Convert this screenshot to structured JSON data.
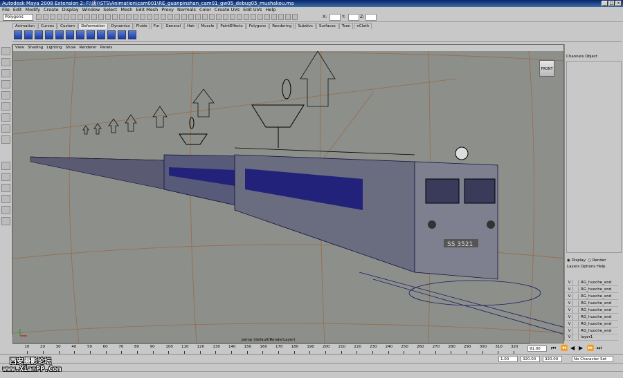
{
  "window": {
    "title": "Autodesk Maya 2008 Extension 2: F:\\唐(\\STS\\Animation\\cam001\\RE_guanpinshan_cam01_gw05_debug05_mushakou.ma"
  },
  "menus": [
    "File",
    "Edit",
    "Modify",
    "Create",
    "Display",
    "Window",
    "Select",
    "Mesh",
    "Edit Mesh",
    "Proxy",
    "Normals",
    "Color",
    "Create UVs",
    "Edit UVs",
    "Help"
  ],
  "status": {
    "mode": "Polygons",
    "coords": [
      "X:",
      "Y:",
      "Z:"
    ]
  },
  "shelf_tabs": [
    "Animation",
    "Curves",
    "Custom",
    "Deformation",
    "Dynamics",
    "Fluids",
    "Fur",
    "General",
    "Hair",
    "Muscle",
    "PaintEffects",
    "Polygons",
    "Rendering",
    "Subdivs",
    "Surfaces",
    "Toon",
    "nCloth"
  ],
  "active_shelf_tab": "Deformation",
  "panel_menu": [
    "View",
    "Shading",
    "Lighting",
    "Show",
    "Renderer",
    "Panels"
  ],
  "viewport": {
    "camera_label": "persp (default/RenderLayer)",
    "viewcube_label": "FRONT",
    "locomotive_number": "SS 3521"
  },
  "channel_box": {
    "tabs": [
      "Channels",
      "Object"
    ]
  },
  "layers": {
    "display_label": "Display",
    "render_label": "Render",
    "menu": [
      "Layers",
      "Options",
      "Help"
    ],
    "items": [
      {
        "vis": "V",
        "name": "RG_huoche_end"
      },
      {
        "vis": "V",
        "name": "RG_huoche_end"
      },
      {
        "vis": "V",
        "name": "RG_huoche_end"
      },
      {
        "vis": "V",
        "name": "RG_huoche_end"
      },
      {
        "vis": "V",
        "name": "RG_huoche_end"
      },
      {
        "vis": "V",
        "name": "RG_huoche_end"
      },
      {
        "vis": "V",
        "name": "RG_huoche_end"
      },
      {
        "vis": "V",
        "name": "RG_huoche_end"
      },
      {
        "vis": "V",
        "name": "layer1"
      }
    ]
  },
  "timeline": {
    "ticks": [
      "10",
      "20",
      "30",
      "40",
      "50",
      "60",
      "70",
      "80",
      "90",
      "100",
      "110",
      "120",
      "130",
      "140",
      "150",
      "160",
      "170",
      "180",
      "190",
      "200",
      "210",
      "220",
      "230",
      "240",
      "250",
      "260",
      "270",
      "280",
      "290",
      "300",
      "310",
      "320"
    ],
    "current_frame": "91.00"
  },
  "range": {
    "start": "1.00",
    "playback_start": "1.00",
    "playback_end": "320.00",
    "end": "320.00",
    "character_set": "No Character Set"
  },
  "watermark": {
    "line1": "西安摄影论坛",
    "line2": "www.XianPP.Com"
  }
}
